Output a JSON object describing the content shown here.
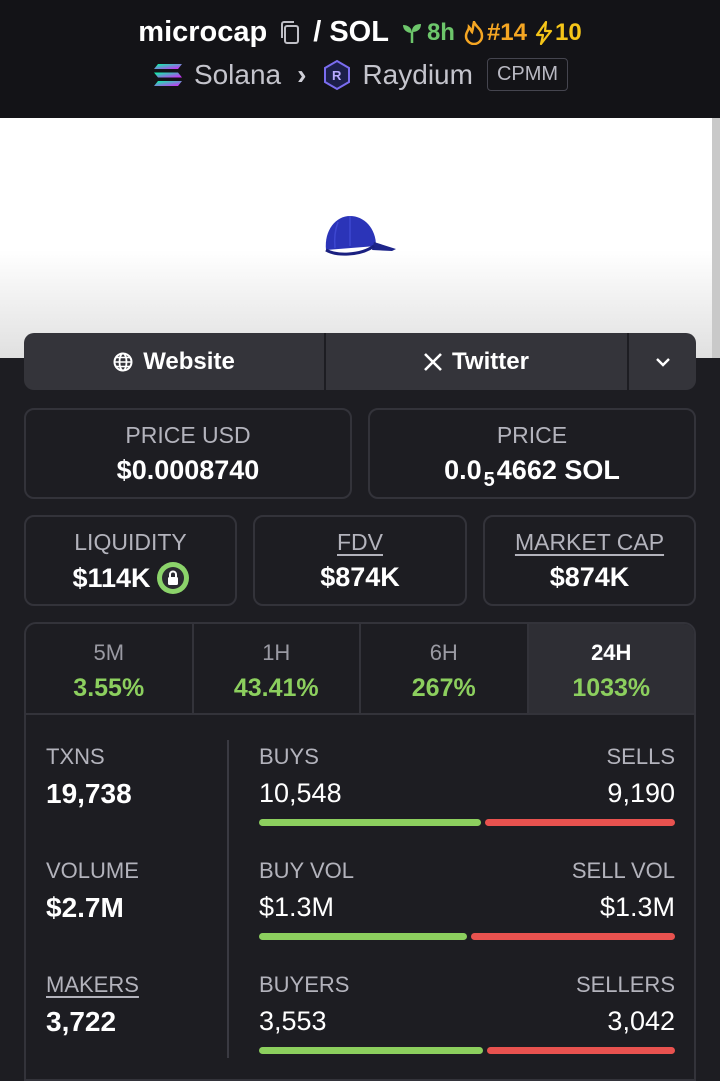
{
  "header": {
    "token": "microcap",
    "separator": "/",
    "quote": "SOL",
    "age": "8h",
    "rank": "#14",
    "boosts": "10",
    "chain": "Solana",
    "dex": "Raydium",
    "pool_type": "CPMM"
  },
  "links": {
    "website": "Website",
    "twitter": "Twitter"
  },
  "price_usd": {
    "label": "PRICE USD",
    "value": "$0.0008740"
  },
  "price": {
    "label": "PRICE",
    "prefix": "0.0",
    "zeros": "5",
    "digits": "4662",
    "unit": "SOL"
  },
  "liquidity": {
    "label": "LIQUIDITY",
    "value": "$114K"
  },
  "fdv": {
    "label": "FDV",
    "value": "$874K"
  },
  "market_cap": {
    "label": "MARKET CAP",
    "value": "$874K"
  },
  "timeframes": [
    {
      "label": "5M",
      "change": "3.55%"
    },
    {
      "label": "1H",
      "change": "43.41%"
    },
    {
      "label": "6H",
      "change": "267%"
    },
    {
      "label": "24H",
      "change": "1033%"
    }
  ],
  "stats": {
    "txns": {
      "label": "TXNS",
      "value": "19,738"
    },
    "volume": {
      "label": "VOLUME",
      "value": "$2.7M"
    },
    "makers": {
      "label": "MAKERS",
      "value": "3,722"
    },
    "buys": {
      "label": "BUYS",
      "value": "10,548",
      "ratio": 0.534
    },
    "sells": {
      "label": "SELLS",
      "value": "9,190"
    },
    "buy_vol": {
      "label": "BUY VOL",
      "value": "$1.3M",
      "ratio": 0.5
    },
    "sell_vol": {
      "label": "SELL VOL",
      "value": "$1.3M"
    },
    "buyers": {
      "label": "BUYERS",
      "value": "3,553",
      "ratio": 0.539
    },
    "sellers": {
      "label": "SELLERS",
      "value": "3,042"
    }
  },
  "colors": {
    "positive": "#8ccf5e",
    "negative": "#e8524f",
    "rank": "#f5a623",
    "age": "#6dc66b"
  }
}
